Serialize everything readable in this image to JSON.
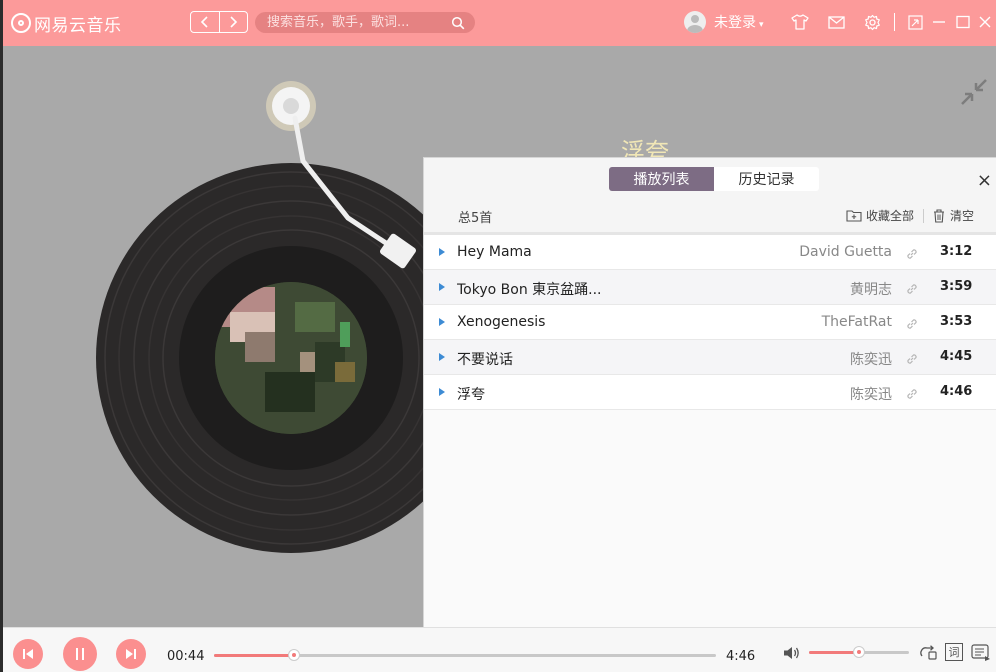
{
  "app": {
    "name": "网易云音乐"
  },
  "search": {
    "placeholder": "搜索音乐，歌手，歌词..."
  },
  "user": {
    "name": "未登录",
    "arrow": "▾"
  },
  "now_playing": {
    "title": "浮夸"
  },
  "playlist_panel": {
    "tabs": [
      {
        "label": "播放列表",
        "active": true
      },
      {
        "label": "历史记录",
        "active": false
      }
    ],
    "count_label": "总5首",
    "collect_all_label": "收藏全部",
    "clear_label": "清空",
    "close_glyph": "×",
    "tracks": [
      {
        "title": "Hey Mama",
        "artist": "David Guetta",
        "duration": "3:12"
      },
      {
        "title": "Tokyo Bon 東京盆踊...",
        "artist": "黄明志",
        "duration": "3:59"
      },
      {
        "title": "Xenogenesis",
        "artist": "TheFatRat",
        "duration": "3:53"
      },
      {
        "title": "不要说话",
        "artist": "陈奕迅",
        "duration": "4:45"
      },
      {
        "title": "浮夸",
        "artist": "陈奕迅",
        "duration": "4:46"
      }
    ]
  },
  "player": {
    "current_time": "00:44",
    "total_time": "4:46",
    "progress_percent": 16,
    "volume_percent": 50,
    "lyrics_label": "词"
  },
  "icons": {
    "back": "chevron-left-icon",
    "forward": "chevron-right-icon",
    "search": "search-icon",
    "skin": "tshirt-icon",
    "mail": "mail-icon",
    "settings": "gear-icon",
    "mini": "mini-mode-icon",
    "minimize": "minimize-icon",
    "maximize": "maximize-icon",
    "close": "close-icon",
    "collapse": "collapse-icon",
    "prev": "previous-track-icon",
    "pause": "pause-icon",
    "next": "next-track-icon",
    "volume": "volume-icon",
    "loop": "loop-icon",
    "playlist": "playlist-icon"
  },
  "colors": {
    "brand": "#fc9a9a",
    "accent": "#f27a7a",
    "tab_active": "#7d6c84",
    "play_marker": "#3d8bd4",
    "song_title": "#f1e7b6"
  }
}
